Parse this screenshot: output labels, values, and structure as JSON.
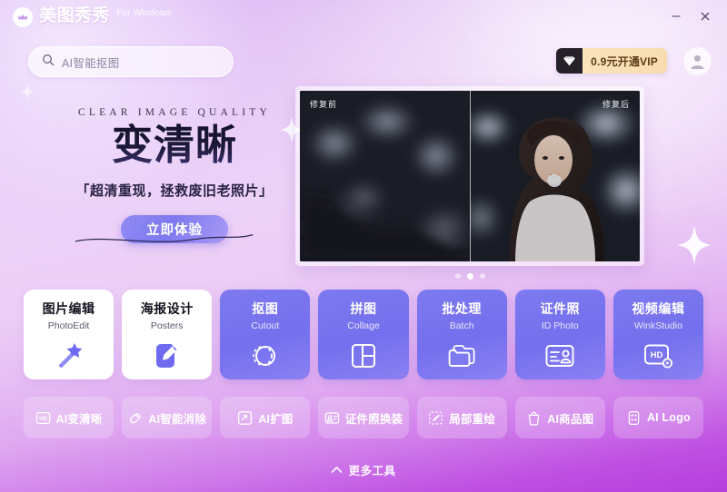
{
  "window": {
    "brand_name": "美图秀秀",
    "brand_sub": "For Windows",
    "minimize_label": "—",
    "close_label": "✕"
  },
  "search": {
    "placeholder": "AI智能抠图",
    "icon": "search-icon"
  },
  "account": {
    "vip_label": "0.9元开通VIP",
    "vip_icon": "diamond-icon",
    "avatar_icon": "user-avatar-icon"
  },
  "hero": {
    "eyebrow": "CLEAR IMAGE QUALITY",
    "title": "变清晰",
    "subtitle": "「超清重现，拯救废旧老照片」",
    "cta": "立即体验",
    "banner": {
      "label_before": "修复前",
      "label_after": "修复后"
    },
    "carousel": {
      "count": 3,
      "active": 1
    }
  },
  "tools": [
    {
      "cn": "图片编辑",
      "en": "PhotoEdit",
      "style": "light",
      "icon": "magic-wand-icon"
    },
    {
      "cn": "海报设计",
      "en": "Posters",
      "style": "light",
      "icon": "pencil-square-icon"
    },
    {
      "cn": "抠图",
      "en": "Cutout",
      "style": "solid",
      "icon": "cutout-circle-icon"
    },
    {
      "cn": "拼图",
      "en": "Collage",
      "style": "solid",
      "icon": "collage-grid-icon"
    },
    {
      "cn": "批处理",
      "en": "Batch",
      "style": "solid",
      "icon": "folder-stack-icon"
    },
    {
      "cn": "证件照",
      "en": "ID Photo",
      "style": "solid",
      "icon": "id-card-icon"
    },
    {
      "cn": "视频编辑",
      "en": "WinkStudio",
      "style": "solid",
      "icon": "hd-video-icon"
    }
  ],
  "ai_chips": [
    {
      "label": "AI变清晰",
      "icon": "hd-badge-icon"
    },
    {
      "label": "AI智能消除",
      "icon": "eraser-icon"
    },
    {
      "label": "AI扩图",
      "icon": "expand-frame-icon"
    },
    {
      "label": "证件照换装",
      "icon": "id-swap-icon"
    },
    {
      "label": "局部重绘",
      "icon": "repaint-brush-icon"
    },
    {
      "label": "AI商品图",
      "icon": "shopping-bag-icon"
    },
    {
      "label": "AI Logo",
      "icon": "logo-grid-icon"
    }
  ],
  "footer": {
    "more_label": "更多工具",
    "more_icon": "chevron-up-icon"
  },
  "colors": {
    "accent_purple": "#7d79ef",
    "bg_top": "#e3c4f5",
    "bg_bottom": "#b63fdd",
    "vip_gold": "#f8dcb0",
    "vip_dark": "#262129"
  }
}
